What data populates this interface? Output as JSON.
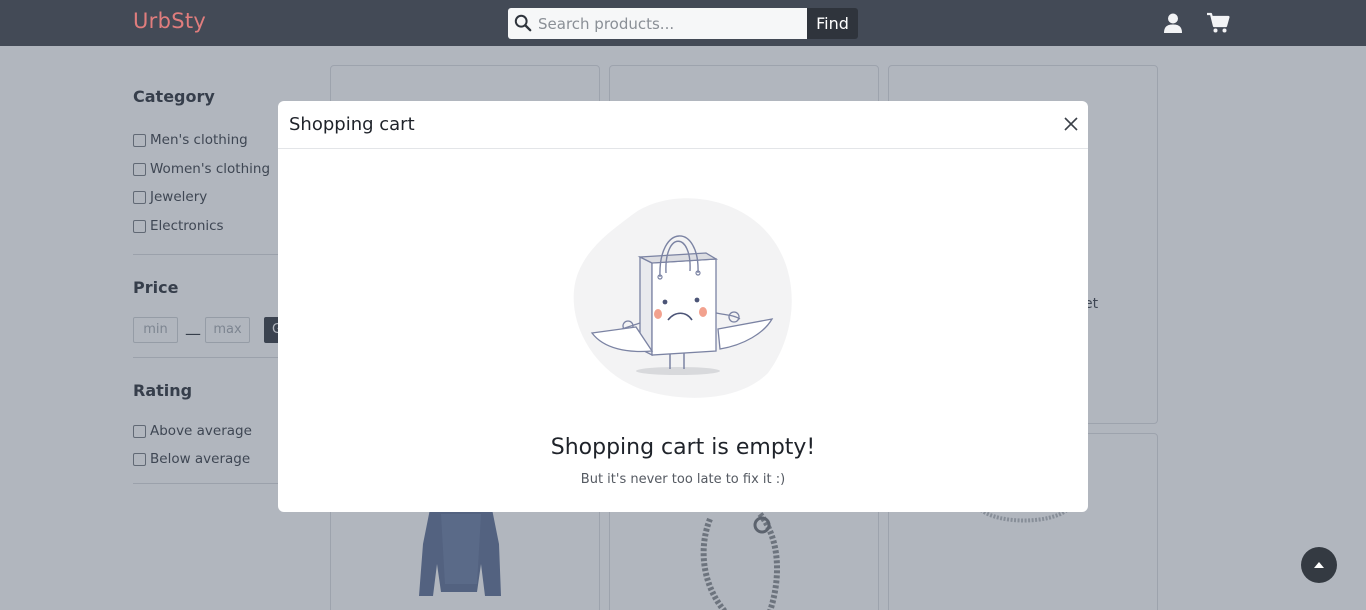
{
  "header": {
    "brand": "UrbSty",
    "search_placeholder": "Search products...",
    "find_label": "Find",
    "user_icon": "user-icon",
    "cart_icon": "cart-icon"
  },
  "sidebar": {
    "category_title": "Category",
    "categories": [
      "Men's clothing",
      "Women's clothing",
      "Jewelery",
      "Electronics"
    ],
    "price_title": "Price",
    "price_min_placeholder": "min",
    "price_max_placeholder": "max",
    "price_go_label": "G",
    "rating_title": "Rating",
    "ratings": [
      "Above average",
      "Below average"
    ]
  },
  "products": {
    "partial_text": "et"
  },
  "modal": {
    "title": "Shopping cart",
    "empty_title": "Shopping cart is empty!",
    "empty_subtitle": "But it's never too late to fix it :)",
    "close_icon": "close-icon"
  },
  "colors": {
    "navbar": "#434a56",
    "brand": "#e07d7d",
    "find_button": "#2f343c",
    "backdrop": "rgba(70,80,100,0.42)"
  }
}
